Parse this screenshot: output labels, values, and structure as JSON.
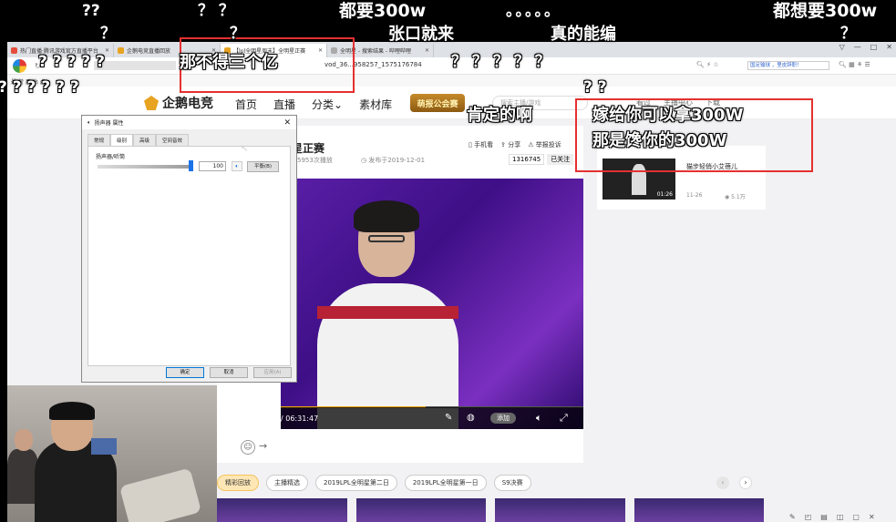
{
  "browser": {
    "tabs": [
      {
        "label": "热门直播·腾讯游戏官方直播平台",
        "color": "#e64d3d"
      },
      {
        "label": "企鹅电竞直播回放",
        "color": "#e7a321"
      },
      {
        "label": "【lpl全明星周末】全明星正赛",
        "color": "#e7a321"
      },
      {
        "label": "全明星 - 搜索结果 - 哔哩哔哩",
        "color": "#aaaaaa"
      }
    ],
    "url": "vod_36...958257_1575176784",
    "bookmark": "最 常 用 站 点",
    "window_controls": [
      "▽",
      "—",
      "□",
      "✕"
    ]
  },
  "site": {
    "logo_text": "企鹅电竞",
    "nav": [
      "首页",
      "直播",
      "分类",
      "素材库"
    ],
    "nav_badge": "萌报公会赛",
    "search_placeholder": "搜索主播/游戏",
    "header_right": [
      "看过",
      "主播中心",
      "下载"
    ]
  },
  "video": {
    "title": "星正赛",
    "views": "5953次播放",
    "published": "发布于2019-12-01",
    "actions": [
      "手机看",
      "分享",
      "举报投诉"
    ],
    "fans": "1316745",
    "follow": "已关注",
    "time": "/ 06:31:47",
    "add_label": "添加",
    "progress": 0.48
  },
  "sidebar_item": {
    "title": "猫步轻俏小艾蓓儿",
    "duration": "01:26",
    "date": "11-26",
    "views": "5.1万"
  },
  "dialog": {
    "title": "扬声器 属性",
    "tabs": [
      "常规",
      "级别",
      "高级",
      "空间音效"
    ],
    "level_label": "扬声器/听筒",
    "level_value": "100",
    "level_fraction": 1.0,
    "balance_button": "平衡(B)",
    "ok": "确定",
    "cancel": "取消",
    "apply": "应用(A)"
  },
  "chips": [
    "精彩回放",
    "主播精选",
    "2019LPL全明星第二日",
    "2019LPL全明星第一日",
    "S9决赛"
  ],
  "danmaku": [
    "??",
    "？ ？",
    "都要300w",
    "。。。。。",
    "都想要300w",
    "？",
    "？",
    "张口就来",
    "真的能编",
    "？",
    "？ ？ ？ ？ ？",
    "那不得三个亿",
    "? ? ? ? ? ?",
    "? ?",
    "肯定的啊",
    "嫁给你可以拿300W",
    "那是馋你的300W",
    "? ? ? ? ?"
  ]
}
